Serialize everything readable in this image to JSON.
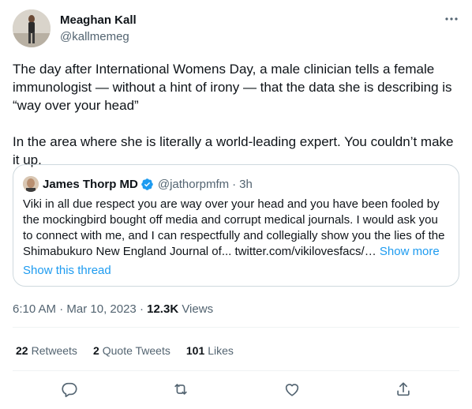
{
  "author": {
    "display_name": "Meaghan Kall",
    "handle": "@kallmemeg"
  },
  "tweet_text": [
    "The day after International Womens Day, a male clinician tells a female immunologist — without a hint of irony — that the data she is describing is “way over your head”",
    "In the area where she is literally a world-leading expert. You couldn’t make it up."
  ],
  "quote": {
    "display_name": "James Thorp MD",
    "handle": "@jathorpmfm",
    "separator": "·",
    "time": "3h",
    "text": "Viki in all due respect you are way over your head and you have been fooled by the mockingbird bought off media and corrupt medical journals. I would ask you to connect with me, and I can respectfully and collegially show you the lies of the Shimabukuro New England Journal of... twitter.com/vikilovesfacs/…",
    "show_more": "Show more",
    "show_thread": "Show this thread"
  },
  "meta": {
    "time": "6:10 AM",
    "separator": "·",
    "date": "Mar 10, 2023",
    "views_count": "12.3K",
    "views_label": "Views"
  },
  "stats": {
    "retweets_count": "22",
    "retweets_label": "Retweets",
    "quotes_count": "2",
    "quotes_label": "Quote Tweets",
    "likes_count": "101",
    "likes_label": "Likes"
  },
  "colors": {
    "text": "#0f1419",
    "secondary": "#536471",
    "accent": "#1d9bf0",
    "border": "#cfd9de"
  },
  "icons": [
    "more-icon",
    "verified-badge-icon",
    "reply-icon",
    "retweet-icon",
    "like-icon",
    "share-icon"
  ]
}
